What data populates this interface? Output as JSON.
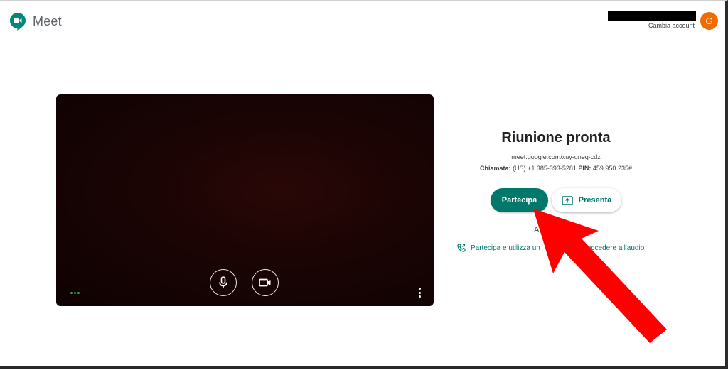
{
  "header": {
    "app_name": "Meet",
    "switch_account_label": "Cambia account",
    "avatar_initial": "G"
  },
  "preview": {
    "mic_icon": "microphone-icon",
    "camera_icon": "video-camera-icon",
    "more_icon": "more-vert-icon"
  },
  "meeting": {
    "title": "Riunione pronta",
    "link": "meet.google.com/xuy-uneq-cdz",
    "dial_label": "Chiamata:",
    "dial_number": "(US) +1 385-393-5281",
    "pin_label": "PIN:",
    "pin_value": "459 950 235#",
    "join_label": "Partecipa",
    "present_label": "Presenta",
    "other_options_label": "A",
    "phone_audio_label": "Partecipa e utilizza un",
    "phone_audio_label_tail": "r accedere all'audio"
  },
  "colors": {
    "accent": "#00796b",
    "avatar": "#ef6c00",
    "annotation_arrow": "#ff0000"
  }
}
